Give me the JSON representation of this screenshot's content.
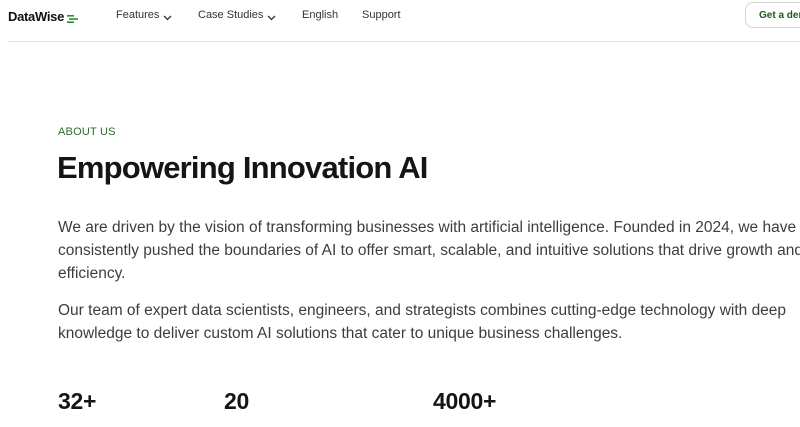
{
  "header": {
    "logo_text": "DataWise",
    "logo_icon": "stacked-lines-icon",
    "nav": {
      "features": "Features",
      "case_studies": "Case Studies",
      "language": "English",
      "support": "Support"
    },
    "cta_label": "Get a demo"
  },
  "about": {
    "eyebrow": "ABOUT US",
    "title": "Empowering Innovation AI",
    "paragraph_1": {
      "line_1": "We are driven by the vision of transforming businesses with artificial intelligence. Founded in 2024, we have",
      "line_2": "consistently pushed the boundaries of AI to offer smart, scalable, and intuitive solutions that drive growth and",
      "line_3": "efficiency."
    },
    "paragraph_2": {
      "line_1": "Our team of expert data scientists, engineers, and strategists combines cutting-edge technology with deep",
      "line_2": "knowledge to deliver custom AI solutions that cater to unique business challenges."
    }
  },
  "stats": [
    "32+",
    "20",
    "4000+"
  ],
  "colors": {
    "accent_green": "#2d6a2d",
    "cta_text": "#1c5a1c",
    "text_dark": "#151515",
    "text_body": "#3d3d3d"
  }
}
